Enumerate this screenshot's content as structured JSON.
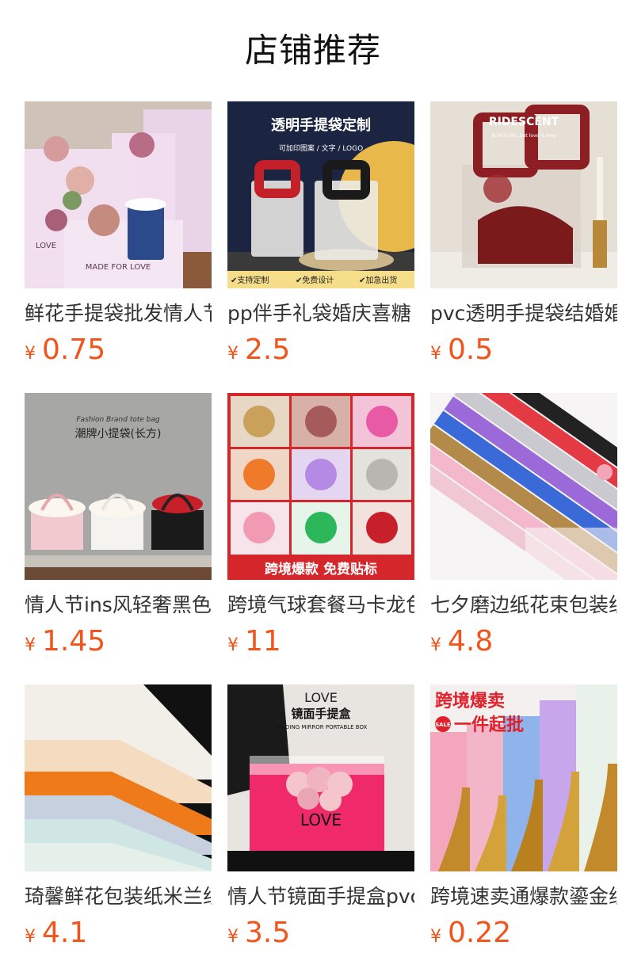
{
  "title": "店铺推荐",
  "currency": "¥",
  "colors": {
    "price": "#f2541b",
    "title": "#111111",
    "name": "#333333"
  },
  "products": [
    {
      "name": "鲜花手提袋批发情人节",
      "price": "0.75",
      "image": {
        "subject": "pink floral handle boxes with roses and a coffee cup",
        "text": [
          "MADE FOR LOVE",
          "LOVE"
        ]
      }
    },
    {
      "name": "pp伴手礼袋婚庆喜糖",
      "price": "2.5",
      "image": {
        "subject": "frosted handbags with red and black handles",
        "text": [
          "透明手提袋定制",
          "可加印图案 / 文字 / LOGO",
          "✔支持定制",
          "✔免费设计",
          "✔加急出货"
        ]
      }
    },
    {
      "name": "pvc透明手提袋结婚婚",
      "price": "0.5",
      "image": {
        "subject": "clear pvc bag with red handle, ribbon and candles",
        "text": [
          "RIDESCENT",
          "Brief is life, but love is long"
        ]
      }
    },
    {
      "name": "情人节ins风轻奢黑色",
      "price": "1.45",
      "image": {
        "subject": "three small flower handbags pink white black",
        "text": [
          "Fashion Brand tote bag",
          "潮牌小提袋(长方)"
        ]
      }
    },
    {
      "name": "跨境气球套餐马卡龙色",
      "price": "11",
      "image": {
        "subject": "grid of balloon arch sets",
        "text": [
          "跨境爆款  免费贴标"
        ]
      }
    },
    {
      "name": "七夕磨边纸花束包装纸",
      "price": "4.8",
      "image": {
        "subject": "rolled colorful wrapping paper",
        "text": []
      }
    },
    {
      "name": "琦馨鲜花包装纸米兰纸",
      "price": "4.1",
      "image": {
        "subject": "stacked frosted wrapping paper sheets",
        "text": []
      }
    },
    {
      "name": "情人节镜面手提盒pvc",
      "price": "3.5",
      "image": {
        "subject": "pink mirror box with roses held by hand",
        "text": [
          "LOVE",
          "镜面手提盒",
          "FOLDING MIRROR PORTABLE BOX",
          "LOVE"
        ]
      }
    },
    {
      "name": "跨境速卖通爆款鎏金纸",
      "price": "0.22",
      "image": {
        "subject": "pastel wrapping paper rolls with gold edges",
        "text": [
          "跨境爆卖",
          "SALE",
          "一件起批"
        ]
      }
    }
  ]
}
